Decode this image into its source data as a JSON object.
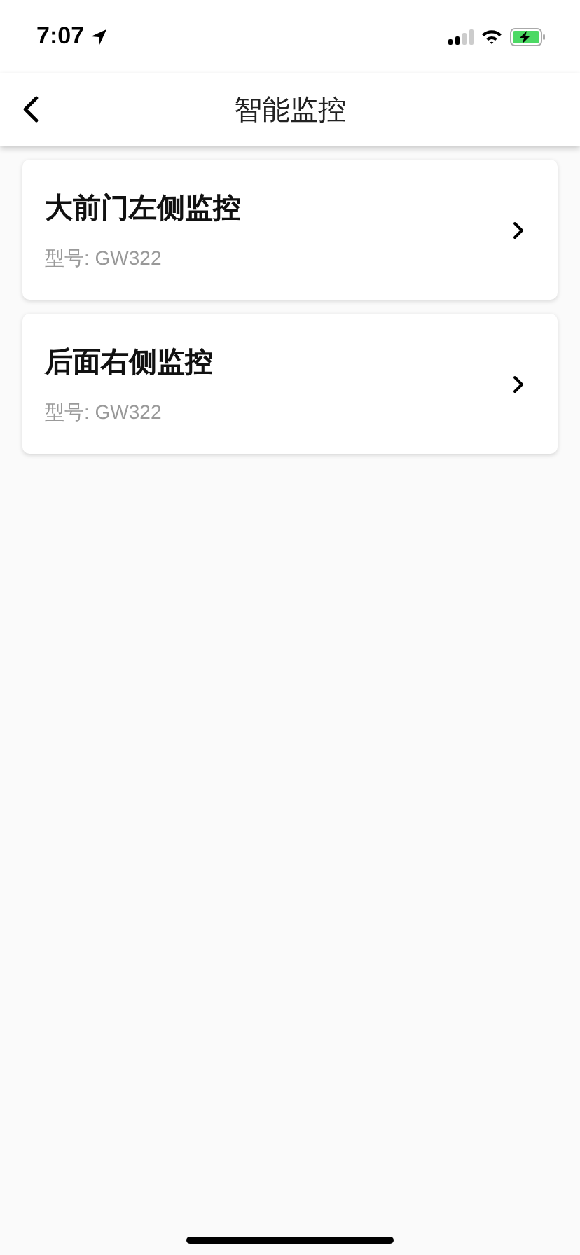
{
  "status_bar": {
    "time": "7:07",
    "battery_charging": true
  },
  "header": {
    "title": "智能监控"
  },
  "devices": [
    {
      "name": "大前门左侧监控",
      "model": "型号: GW322"
    },
    {
      "name": "后面右侧监控",
      "model": "型号: GW322"
    }
  ]
}
